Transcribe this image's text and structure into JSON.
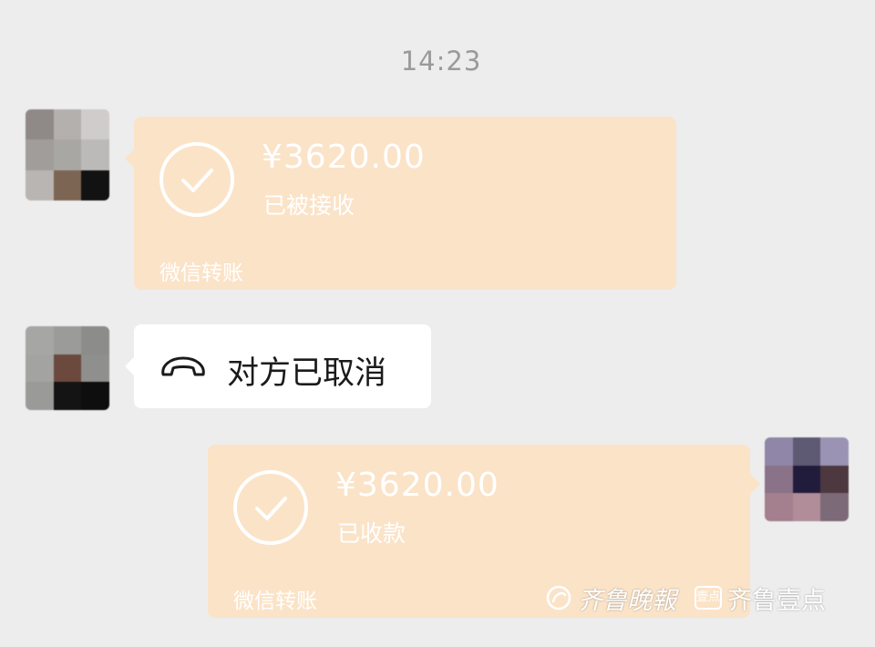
{
  "chat": {
    "timestamp": "14:23",
    "messages": [
      {
        "side": "left",
        "type": "transfer",
        "amount": "¥3620.00",
        "status": "已被接收",
        "footer": "微信转账"
      },
      {
        "side": "left",
        "type": "call",
        "icon": "hang-up-phone-icon",
        "text": "对方已取消"
      },
      {
        "side": "right",
        "type": "transfer",
        "amount": "¥3620.00",
        "status": "已收款",
        "footer": "微信转账"
      }
    ]
  },
  "watermark": {
    "brand1": "齐鲁晚報",
    "badge": "壹点",
    "brand2": "齐鲁壹点"
  },
  "colors": {
    "background": "#ededed",
    "transfer_bubble": "#fbe3c8",
    "text_bubble": "#ffffff",
    "timestamp": "#9a9a9a"
  }
}
